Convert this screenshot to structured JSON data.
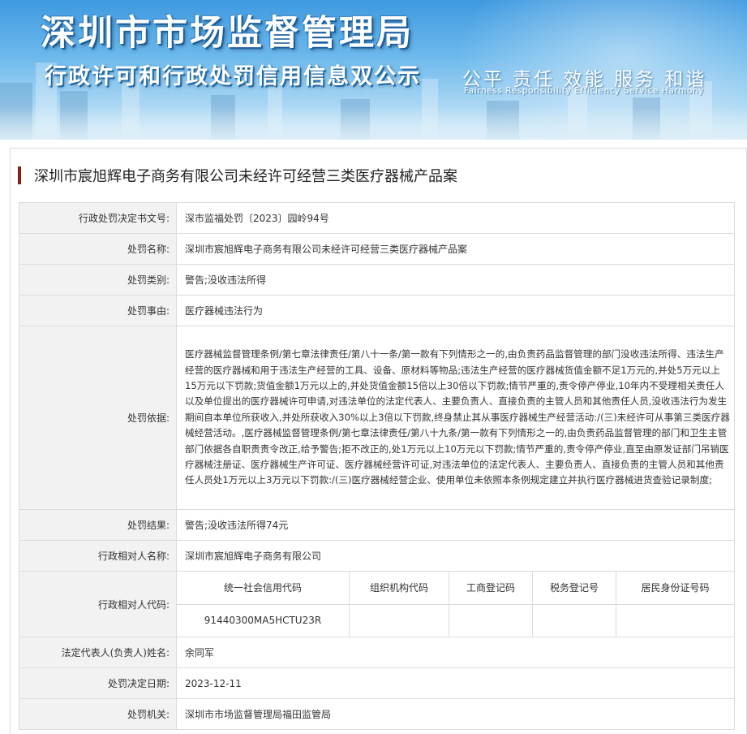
{
  "header": {
    "title": "深圳市市场监督管理局",
    "subtitle": "行政许可和行政处罚信用信息双公示",
    "motto": "公平  责任  效能  服务  和谐",
    "motto_en": "Fairness  Responsibility  Efficiency  Service  Harmony"
  },
  "case": {
    "title": "深圳市宸旭辉电子商务有限公司未经许可经营三类医疗器械产品案"
  },
  "labels": {
    "decision_no": "行政处罚决定书文号:",
    "penalty_name": "处罚名称:",
    "penalty_type": "处罚类别:",
    "penalty_reason": "处罚事由:",
    "penalty_basis": "处罚依据:",
    "penalty_result": "处罚结果:",
    "party_name": "行政相对人名称:",
    "party_code": "行政相对人代码:",
    "legal_rep": "法定代表人(负责人)姓名:",
    "decision_date": "处罚决定日期:",
    "authority": "处罚机关:"
  },
  "values": {
    "decision_no": "深市监福处罚〔2023〕园岭94号",
    "penalty_name": "深圳市宸旭辉电子商务有限公司未经许可经营三类医疗器械产品案",
    "penalty_type": "警告;没收违法所得",
    "penalty_reason": "医疗器械违法行为",
    "penalty_basis": "医疗器械监督管理条例/第七章法律责任/第八十一条/第一款有下列情形之一的,由负责药品监督管理的部门没收违法所得、违法生产经营的医疗器械和用于违法生产经营的工具、设备、原材料等物品;违法生产经营的医疗器械货值金额不足1万元的,并处5万元以上15万元以下罚款;货值金额1万元以上的,并处货值金额15倍以上30倍以下罚款;情节严重的,责令停产停业,10年内不受理相关责任人以及单位提出的医疗器械许可申请,对违法单位的法定代表人、主要负责人、直接负责的主管人员和其他责任人员,没收违法行为发生期间自本单位所获收入,并处所获收入30%以上3倍以下罚款,终身禁止其从事医疗器械生产经营活动:/(三)未经许可从事第三类医疗器械经营活动。,医疗器械监督管理条例/第七章法律责任/第八十九条/第一款有下列情形之一的,由负责药品监督管理的部门和卫生主管部门依据各自职责责令改正,给予警告;拒不改正的,处1万元以上10万元以下罚款;情节严重的,责令停产停业,直至由原发证部门吊销医疗器械注册证、医疗器械生产许可证、医疗器械经营许可证,对违法单位的法定代表人、主要负责人、直接负责的主管人员和其他责任人员处1万元以上3万元以下罚款:/(三)医疗器械经营企业、使用单位未依照本条例规定建立并执行医疗器械进货查验记录制度;",
    "penalty_result": "警告;没收违法所得74元",
    "party_name": "深圳市宸旭辉电子商务有限公司",
    "legal_rep": "余同军",
    "decision_date": "2023-12-11",
    "authority": "深圳市市场监督管理局福田监管局"
  },
  "codes": {
    "headers": [
      "统一社会信用代码",
      "组织机构代码",
      "工商登记码",
      "税务登记号",
      "居民身份证号码"
    ],
    "values": [
      "91440300MA5HCTU23R",
      "",
      "",
      "",
      ""
    ]
  },
  "colors": {
    "title_bar": "#8b1a1a",
    "label_bg": "#f2f2f2",
    "border": "#dcdcdc"
  }
}
